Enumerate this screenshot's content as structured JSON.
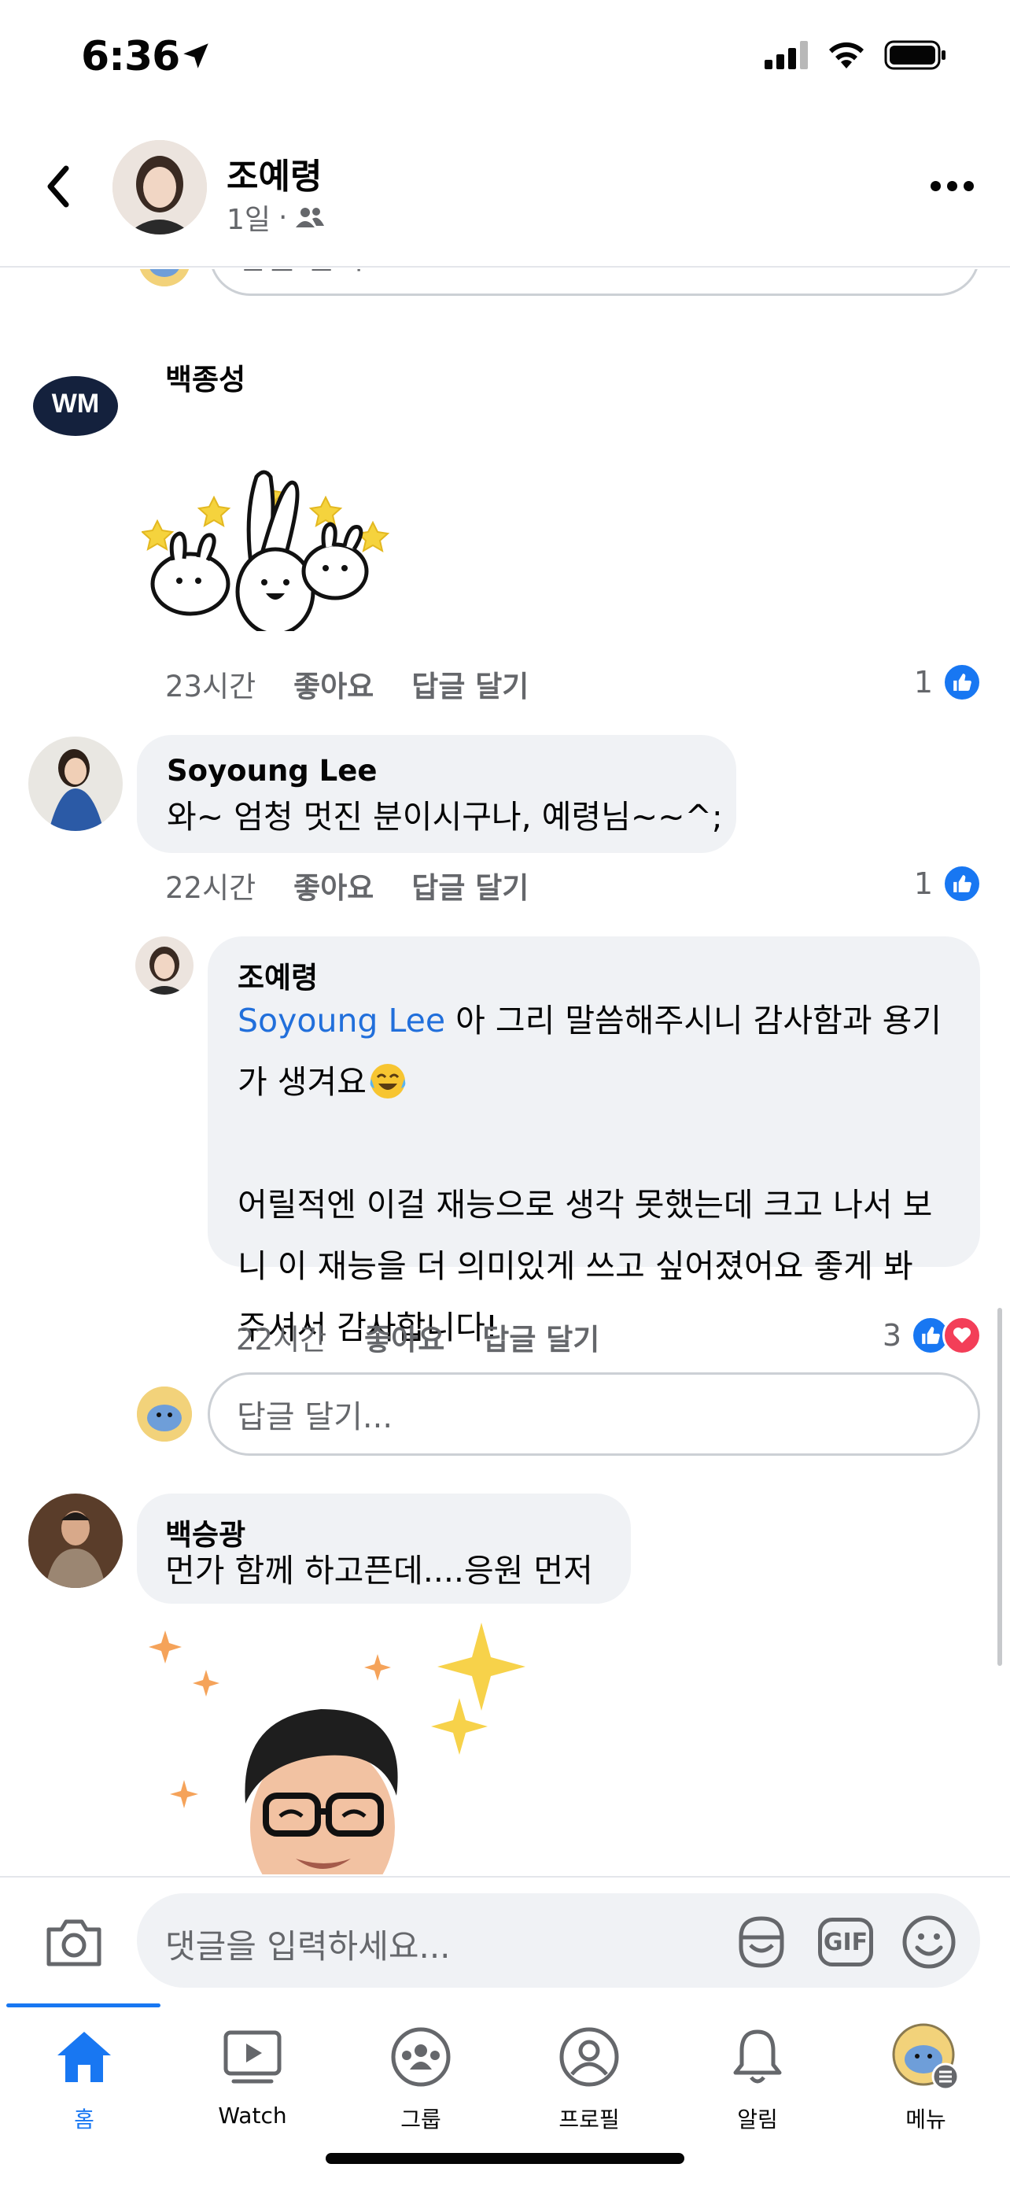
{
  "status_bar": {
    "time": "6:36"
  },
  "header": {
    "name": "조예령",
    "age": "1일",
    "separator": "·"
  },
  "comments": [
    {
      "name": "백종성",
      "time": "23시간",
      "like": "좋아요",
      "reply": "답글 달기",
      "reactions": "1"
    },
    {
      "name": "Soyoung Lee",
      "text": "와~ 엄청 멋진 분이시구나, 예령님~~^;",
      "time": "22시간",
      "like": "좋아요",
      "reply": "답글 달기",
      "reactions": "1"
    },
    {
      "name": "조예령",
      "mention": "Soyoung Lee",
      "line1": " 아 그리 말씀해주시니 감사함과 용기",
      "line2": "가 생겨요",
      "line3": "어릴적엔 이걸 재능으로 생각 못했는데 크고 나서 보",
      "line4": "니 이 재능을 더 의미있게 쓰고 싶어졌어요 좋게 봐",
      "line5": "주셔서 감사합니다!",
      "time": "22시간",
      "like": "좋아요",
      "reply": "답글 달기",
      "reactions": "3"
    },
    {
      "name": "백승광",
      "text": "먼가 함께 하고픈데....응원 먼저"
    }
  ],
  "reply_input": {
    "placeholder": "답글 달기..."
  },
  "composer": {
    "placeholder": "댓글을 입력하세요...",
    "gif": "GIF"
  },
  "tabs": [
    {
      "label": "홈",
      "icon": "home-icon"
    },
    {
      "label": "Watch",
      "icon": "watch-icon"
    },
    {
      "label": "그룹",
      "icon": "groups-icon"
    },
    {
      "label": "프로필",
      "icon": "profile-icon"
    },
    {
      "label": "알림",
      "icon": "bell-icon"
    },
    {
      "label": "메뉴",
      "icon": "menu-avatar-icon"
    }
  ],
  "colors": {
    "accent": "#1877f2",
    "bubble": "#f0f2f5",
    "secondary_text": "#65676b",
    "heart": "#f33e58",
    "mention": "#216fdb"
  }
}
